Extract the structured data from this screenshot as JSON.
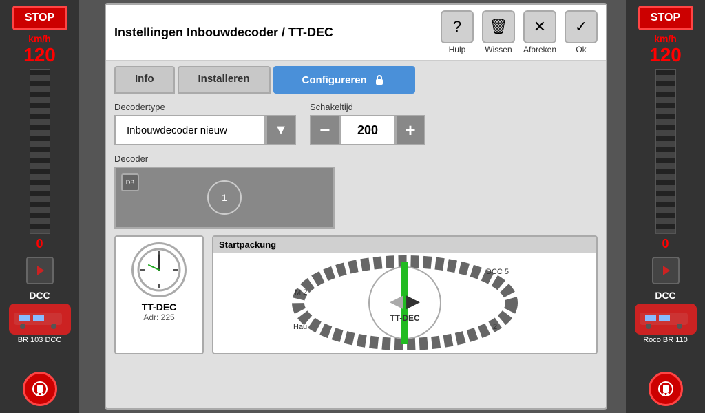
{
  "left_sidebar": {
    "stop_label": "STOP",
    "speed_label": "km/h",
    "speed_value": "120",
    "speed_zero": "0",
    "mode_label": "DCC",
    "train_name": "BR 103 DCC"
  },
  "right_sidebar": {
    "stop_label": "STOP",
    "speed_label": "km/h",
    "speed_value": "120",
    "speed_zero": "0",
    "mode_label": "DCC",
    "train_name": "Roco BR 110"
  },
  "dialog": {
    "title": "Instellingen Inbouwdecoder / TT-DEC",
    "toolbar": {
      "help_label": "Hulp",
      "delete_label": "Wissen",
      "cancel_label": "Afbreken",
      "ok_label": "Ok"
    },
    "tabs": {
      "info_label": "Info",
      "installeren_label": "Installeren",
      "configureren_label": "Configureren"
    },
    "decoder_type_label": "Decodertype",
    "decoder_type_value": "Inbouwdecoder nieuw",
    "schakeltijd_label": "Schakeltijd",
    "schakeltijd_value": "200",
    "decoder_label": "Decoder",
    "decoder_chip_label": "DB",
    "decoder_circle_label": "1",
    "tt_dec": {
      "name": "TT-DEC",
      "address_label": "Adr: 225"
    },
    "startpackung": {
      "label": "Startpackung",
      "haup_label": "Hau",
      "center_label": "TT-DEC",
      "m2_label": "M 2",
      "dcc5_label": "DCC 5"
    }
  }
}
